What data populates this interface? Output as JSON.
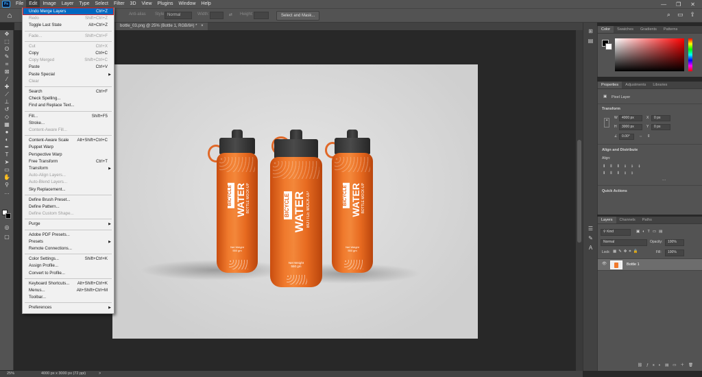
{
  "menubar": {
    "logo": "Ps",
    "items": [
      "File",
      "Edit",
      "Image",
      "Layer",
      "Type",
      "Select",
      "Filter",
      "3D",
      "View",
      "Plugins",
      "Window",
      "Help"
    ],
    "window_controls": [
      "—",
      "❐",
      "✕"
    ]
  },
  "options": {
    "style_label": "Style:",
    "style_value": "Normal",
    "width_label": "Width:",
    "height_label": "Height:",
    "select_mask": "Select and Mask...",
    "antialias": "Anti-alias"
  },
  "tab": {
    "label": "bottle_03.png @ 25% (Bottle 1, RGB/8#) *",
    "close": "×"
  },
  "edit_menu": [
    {
      "label": "Undo Merge Layers",
      "shortcut": "Ctrl+Z",
      "state": "hl"
    },
    {
      "label": "Redo",
      "shortcut": "Shift+Ctrl+Z",
      "state": "dis"
    },
    {
      "label": "Toggle Last State",
      "shortcut": "Alt+Ctrl+Z",
      "state": ""
    },
    {
      "sep": true
    },
    {
      "label": "Fade...",
      "shortcut": "Shift+Ctrl+F",
      "state": "dis"
    },
    {
      "sep": true
    },
    {
      "label": "Cut",
      "shortcut": "Ctrl+X",
      "state": "dis"
    },
    {
      "label": "Copy",
      "shortcut": "Ctrl+C",
      "state": ""
    },
    {
      "label": "Copy Merged",
      "shortcut": "Shift+Ctrl+C",
      "state": "dis"
    },
    {
      "label": "Paste",
      "shortcut": "Ctrl+V",
      "state": ""
    },
    {
      "label": "Paste Special",
      "shortcut": "",
      "state": "",
      "sub": true
    },
    {
      "label": "Clear",
      "shortcut": "",
      "state": "dis"
    },
    {
      "sep": true
    },
    {
      "label": "Search",
      "shortcut": "Ctrl+F",
      "state": ""
    },
    {
      "label": "Check Spelling...",
      "shortcut": "",
      "state": ""
    },
    {
      "label": "Find and Replace Text...",
      "shortcut": "",
      "state": ""
    },
    {
      "sep": true
    },
    {
      "label": "Fill...",
      "shortcut": "Shift+F5",
      "state": ""
    },
    {
      "label": "Stroke...",
      "shortcut": "",
      "state": ""
    },
    {
      "label": "Content-Aware Fill...",
      "shortcut": "",
      "state": "dis"
    },
    {
      "sep": true
    },
    {
      "label": "Content-Aware Scale",
      "shortcut": "Alt+Shift+Ctrl+C",
      "state": ""
    },
    {
      "label": "Puppet Warp",
      "shortcut": "",
      "state": ""
    },
    {
      "label": "Perspective Warp",
      "shortcut": "",
      "state": ""
    },
    {
      "label": "Free Transform",
      "shortcut": "Ctrl+T",
      "state": ""
    },
    {
      "label": "Transform",
      "shortcut": "",
      "state": "",
      "sub": true
    },
    {
      "label": "Auto-Align Layers...",
      "shortcut": "",
      "state": "dis"
    },
    {
      "label": "Auto-Blend Layers...",
      "shortcut": "",
      "state": "dis"
    },
    {
      "label": "Sky Replacement...",
      "shortcut": "",
      "state": ""
    },
    {
      "sep": true
    },
    {
      "label": "Define Brush Preset...",
      "shortcut": "",
      "state": ""
    },
    {
      "label": "Define Pattern...",
      "shortcut": "",
      "state": ""
    },
    {
      "label": "Define Custom Shape...",
      "shortcut": "",
      "state": "dis"
    },
    {
      "sep": true
    },
    {
      "label": "Purge",
      "shortcut": "",
      "state": "",
      "sub": true
    },
    {
      "sep": true
    },
    {
      "label": "Adobe PDF Presets...",
      "shortcut": "",
      "state": ""
    },
    {
      "label": "Presets",
      "shortcut": "",
      "state": "",
      "sub": true
    },
    {
      "label": "Remote Connections...",
      "shortcut": "",
      "state": ""
    },
    {
      "sep": true
    },
    {
      "label": "Color Settings...",
      "shortcut": "Shift+Ctrl+K",
      "state": ""
    },
    {
      "label": "Assign Profile...",
      "shortcut": "",
      "state": ""
    },
    {
      "label": "Convert to Profile...",
      "shortcut": "",
      "state": ""
    },
    {
      "sep": true
    },
    {
      "label": "Keyboard Shortcuts...",
      "shortcut": "Alt+Shift+Ctrl+K",
      "state": ""
    },
    {
      "label": "Menus...",
      "shortcut": "Alt+Shift+Ctrl+M",
      "state": ""
    },
    {
      "label": "Toolbar...",
      "shortcut": "",
      "state": ""
    },
    {
      "sep": true
    },
    {
      "label": "Preferences",
      "shortcut": "",
      "state": "",
      "sub": true
    }
  ],
  "bottle": {
    "brand": "BICYCLE",
    "title": "WATER",
    "sub": "BOTTLE MOCK-UP",
    "net1": "Net Weight",
    "net2": "550 gm"
  },
  "color_panel": {
    "tabs": [
      "Color",
      "Swatches",
      "Gradients",
      "Patterns"
    ]
  },
  "properties": {
    "tabs": [
      "Properties",
      "Adjustments",
      "Libraries"
    ],
    "layer_type": "Pixel Layer",
    "transform": "Transform",
    "w_label": "W",
    "w": "4000 px",
    "h_label": "H",
    "h": "3000 px",
    "x_label": "X",
    "x": "0 px",
    "y_label": "Y",
    "y": "0 px",
    "angle": "0.00°",
    "align_title": "Align and Distribute",
    "align_label": "Align:",
    "quick": "Quick Actions"
  },
  "layers": {
    "tabs": [
      "Layers",
      "Channels",
      "Paths"
    ],
    "kind": "Kind",
    "blend": "Normal",
    "opacity_label": "Opacity:",
    "opacity": "100%",
    "lock_label": "Lock:",
    "fill_label": "Fill:",
    "fill": "100%",
    "layer_name": "Bottle 1"
  },
  "status": {
    "zoom": "25%",
    "size": "4000 px x 3000 px (72 ppi)",
    "arrow": ">"
  },
  "colors": {
    "accent": "#0067c0",
    "bottle": "#f07a2d"
  }
}
